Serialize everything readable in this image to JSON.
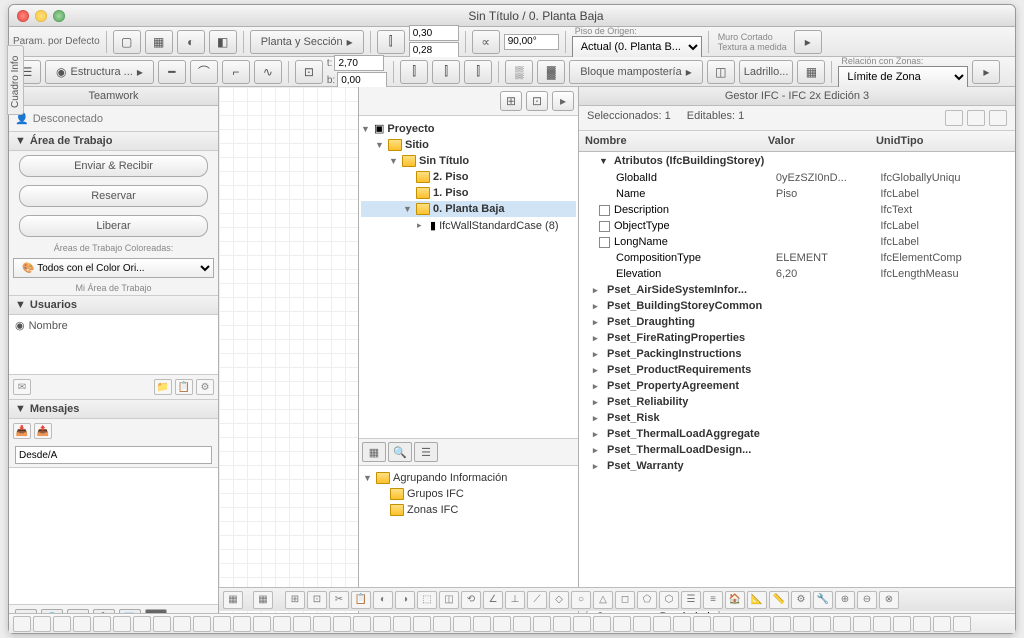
{
  "window": {
    "title": "Sin Título / 0. Planta Baja"
  },
  "toolbar1": {
    "param_label": "Param. por Defecto",
    "plan_section": "Planta y Sección",
    "dim_t": "0,30",
    "dim_b": "0,28",
    "angle": "90,00°",
    "origin_label": "Piso de Origen:",
    "origin_value": "Actual (0. Planta B...",
    "muro": "Muro Cortado",
    "textura": "Textura a medida"
  },
  "toolbar2": {
    "structure": "Estructura ...",
    "t_label": "t:",
    "b_label": "b:",
    "val_t": "2,70",
    "val_b": "0,00",
    "block": "Bloque mampostería",
    "ladrillo": "Ladrillo...",
    "zone_label": "Relación con Zonas:",
    "zone_value": "Límite de Zona"
  },
  "left_tab": "Cuadro Info",
  "sidebar": {
    "teamwork": "Teamwork",
    "desconectado": "Desconectado",
    "area_trabajo": "Área de Trabajo",
    "enviar": "Enviar & Recibir",
    "reservar": "Reservar",
    "liberar": "Liberar",
    "coloreadas": "Áreas de Trabajo Coloreadas:",
    "color_ori": "Todos con el Color Ori...",
    "mi_area": "Mi Área de Trabajo",
    "usuarios": "Usuarios",
    "nombre": "Nombre",
    "mensajes": "Mensajes",
    "desde": "Desde/A"
  },
  "tree": {
    "proyecto": "Proyecto",
    "sitio": "Sitio",
    "sintitulo": "Sin Título",
    "piso2": "2. Piso",
    "piso1": "1. Piso",
    "planta_baja": "0. Planta Baja",
    "ifcwall": "IfcWallStandardCase (8)"
  },
  "grouping": {
    "header": "Agrupando Información",
    "grupos_ifc": "Grupos IFC",
    "zonas_ifc": "Zonas IFC"
  },
  "right": {
    "title": "Gestor IFC - IFC 2x Edición 3",
    "seleccionados": "Seleccionados:  1",
    "editables": "Editables:  1",
    "col_nombre": "Nombre",
    "col_valor": "Valor",
    "col_unidtipo": "UnidTipo",
    "attr_header": "Atributos (IfcBuildingStorey)",
    "attrs": [
      {
        "name": "GlobalId",
        "value": "0yEzSZI0nD...",
        "type": "IfcGloballyUniqu",
        "cb": false
      },
      {
        "name": "Name",
        "value": "Piso",
        "type": "IfcLabel",
        "cb": false
      },
      {
        "name": "Description",
        "value": "",
        "type": "IfcText",
        "cb": true
      },
      {
        "name": "ObjectType",
        "value": "",
        "type": "IfcLabel",
        "cb": true
      },
      {
        "name": "LongName",
        "value": "",
        "type": "IfcLabel",
        "cb": true
      },
      {
        "name": "CompositionType",
        "value": "ELEMENT",
        "type": "IfcElementComp",
        "cb": false
      },
      {
        "name": "Elevation",
        "value": "6,20",
        "type": "IfcLengthMeasu",
        "cb": false
      }
    ],
    "psets": [
      "Pset_AirSideSystemInfor...",
      "Pset_BuildingStoreyCommon",
      "Pset_Draughting",
      "Pset_FireRatingProperties",
      "Pset_PackingInstructions",
      "Pset_ProductRequirements",
      "Pset_PropertyAgreement",
      "Pset_Reliability",
      "Pset_Risk",
      "Pset_ThermalLoadAggregate",
      "Pset_ThermalLoadDesign...",
      "Pset_Warranty"
    ],
    "crear": "Crear nueva Propiedad"
  }
}
